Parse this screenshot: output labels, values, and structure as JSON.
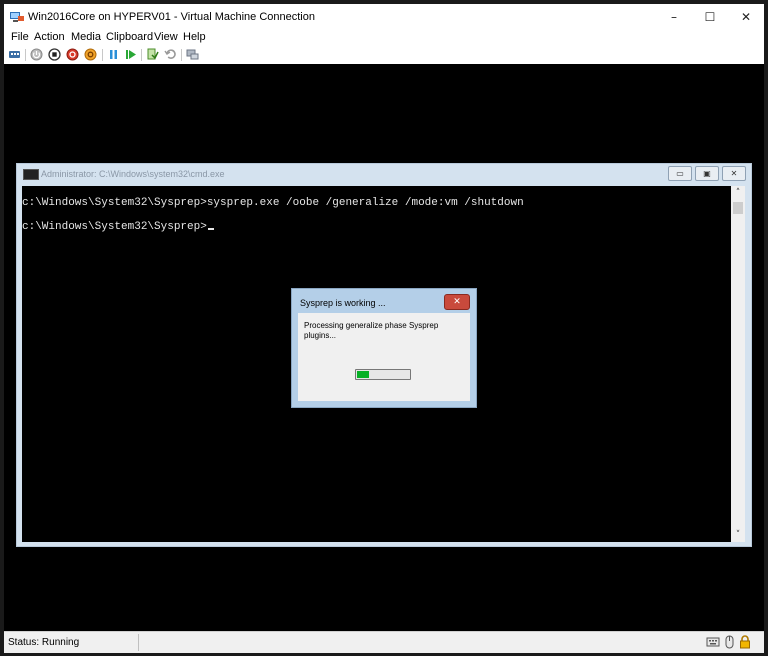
{
  "window": {
    "title": "Win2016Core on HYPERV01 - Virtual Machine Connection",
    "minimize": "–",
    "maximize": "☐",
    "close": "✕"
  },
  "menu": [
    "File",
    "Action",
    "Media",
    "Clipboard",
    "View",
    "Help"
  ],
  "toolbar": [
    "ctrl-alt-del-icon",
    "start-icon",
    "turn-off-icon",
    "shut-down-icon",
    "save-icon",
    "pause-icon",
    "resume-icon",
    "checkpoint-icon",
    "revert-icon",
    "enhanced-session-icon"
  ],
  "cmd_window": {
    "title": "Administrator: C:\\Windows\\system32\\cmd.exe",
    "lines": [
      "c:\\Windows\\System32\\Sysprep>sysprep.exe /oobe /generalize /mode:vm /shutdown",
      "c:\\Windows\\System32\\Sysprep>"
    ]
  },
  "dialog": {
    "title": "Sysprep is working ...",
    "close": "✕",
    "message": "Processing generalize phase Sysprep plugins..."
  },
  "status": {
    "text": "Status: Running"
  },
  "colors": {
    "progress_fill": "#06b025",
    "screen": "#000000"
  }
}
